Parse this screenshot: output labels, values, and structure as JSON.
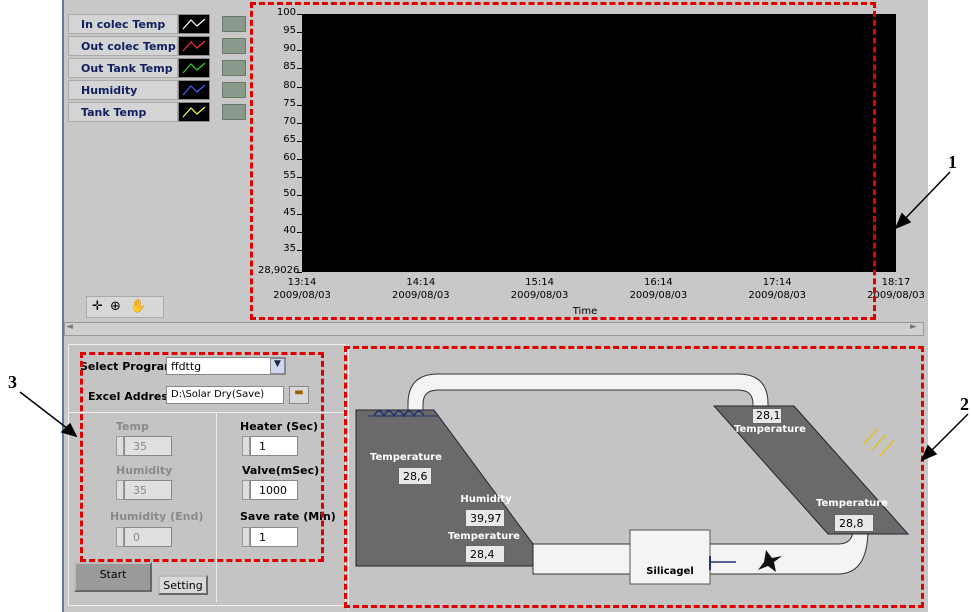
{
  "legend": [
    {
      "label": "In colec Temp",
      "color": "#ffffff"
    },
    {
      "label": "Out colec Temp",
      "color": "#ff3030"
    },
    {
      "label": "Out Tank Temp",
      "color": "#30d030"
    },
    {
      "label": "Humidity",
      "color": "#4060ff"
    },
    {
      "label": "Tank Temp",
      "color": "#ffff40"
    }
  ],
  "chart_data": {
    "type": "line",
    "xlabel": "Time",
    "ylabel": "",
    "ylim": [
      28.9026,
      100
    ],
    "y_ticks": [
      "100",
      "95",
      "90",
      "85",
      "80",
      "75",
      "70",
      "65",
      "60",
      "55",
      "50",
      "45",
      "40",
      "35",
      "28,9026"
    ],
    "x_ticks": [
      {
        "time": "13:14",
        "date": "2009/08/03"
      },
      {
        "time": "14:14",
        "date": "2009/08/03"
      },
      {
        "time": "15:14",
        "date": "2009/08/03"
      },
      {
        "time": "16:14",
        "date": "2009/08/03"
      },
      {
        "time": "17:14",
        "date": "2009/08/03"
      },
      {
        "time": "18:17",
        "date": "2009/08/03"
      }
    ],
    "background": "#000000",
    "series": []
  },
  "controls": {
    "select_program_label": "Select Program",
    "select_program_value": "ffdttg",
    "excel_address_label": "Excel Address",
    "excel_address_value": "D:\\Solar Dry(Save)",
    "temp_label": "Temp",
    "temp_value": "35",
    "humidity_label": "Humidity",
    "humidity_value": "35",
    "humidity_end_label": "Humidity (End)",
    "humidity_end_value": "0",
    "heater_label": "Heater (Sec)",
    "heater_value": "1",
    "valve_label": "Valve(mSec)",
    "valve_value": "1000",
    "save_rate_label": "Save rate (Min)",
    "save_rate_value": "1",
    "start_label": "Start",
    "setting_label": "Setting"
  },
  "diagram": {
    "left_temp_label": "Temperature",
    "left_temp_value": "28,6",
    "humidity_label": "Humidity",
    "humidity_value": "39,97",
    "bottom_temp_label": "Temperature",
    "bottom_temp_value": "28,4",
    "right_top_value": "28,1",
    "right_top_label": "Temperature",
    "right_bottom_label": "Temperature",
    "right_bottom_value": "28,8",
    "silicagel_label": "Silicagel"
  },
  "callouts": {
    "one": "1",
    "two": "2",
    "three": "3"
  }
}
